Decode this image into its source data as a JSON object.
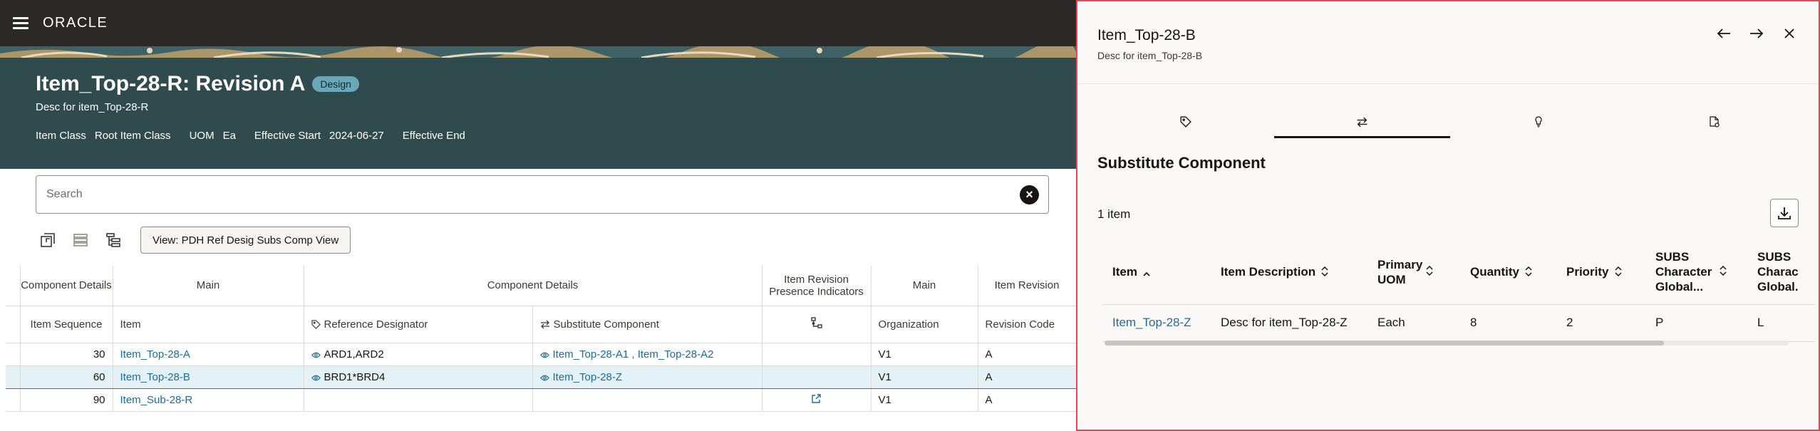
{
  "app": {
    "brand": "ORACLE"
  },
  "header": {
    "title": "Item_Top-28-R: Revision A",
    "status_badge": "Design",
    "description": "Desc for item_Top-28-R",
    "meta": [
      {
        "label": "Item Class",
        "value": "Root Item Class"
      },
      {
        "label": "UOM",
        "value": "Ea"
      },
      {
        "label": "Effective Start",
        "value": "2024-06-27"
      },
      {
        "label": "Effective End",
        "value": ""
      }
    ]
  },
  "search": {
    "placeholder": "Search",
    "value": ""
  },
  "toolbar": {
    "view_label": "View: PDH Ref Desig Subs Comp View"
  },
  "structure_table": {
    "group_headers": {
      "component_details_1": "Component Details",
      "main_1": "Main",
      "component_details_2": "Component Details",
      "item_revision_presence": "Item Revision Presence Indicators",
      "main_2": "Main",
      "item_revision": "Item Revision"
    },
    "columns": {
      "item_sequence": "Item Sequence",
      "item": "Item",
      "reference_designator": "Reference Designator",
      "substitute_component": "Substitute Component",
      "organization": "Organization",
      "revision_code": "Revision Code"
    },
    "rows": [
      {
        "seq": "30",
        "item": "Item_Top-28-A",
        "ref_desig": "ARD1,ARD2",
        "subs": "Item_Top-28-A1 , Item_Top-28-A2",
        "org": "V1",
        "rev": "A"
      },
      {
        "seq": "60",
        "item": "Item_Top-28-B",
        "ref_desig": "BRD1*BRD4",
        "subs": "Item_Top-28-Z",
        "org": "V1",
        "rev": "A"
      },
      {
        "seq": "90",
        "item": "Item_Sub-28-R",
        "ref_desig": "",
        "subs": "",
        "org": "V1",
        "rev": "A"
      }
    ]
  },
  "drawer": {
    "title": "Item_Top-28-B",
    "description": "Desc for item_Top-28-B",
    "section_title": "Substitute Component",
    "count_text": "1 item",
    "columns": {
      "item": "Item",
      "item_description": "Item Description",
      "primary_uom": "Primary UOM",
      "quantity": "Quantity",
      "priority": "Priority",
      "subs_char_1": "SUBS Character Global...",
      "subs_char_2": "SUBS Charac Global."
    },
    "rows": [
      {
        "item": "Item_Top-28-Z",
        "item_description": "Desc for item_Top-28-Z",
        "primary_uom": "Each",
        "quantity": "8",
        "priority": "2",
        "subs_char_1": "P",
        "subs_char_2": "L"
      }
    ]
  },
  "colors": {
    "header_bg": "#304b4d",
    "topbar_bg": "#2b2928",
    "link": "#1b6c9e",
    "drawer_border": "#e04c53",
    "selected_row": "#e4f1f7"
  }
}
